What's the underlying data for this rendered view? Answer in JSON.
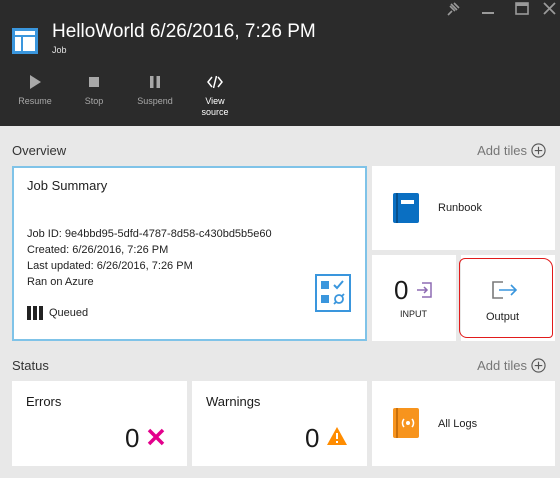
{
  "header": {
    "title": "HelloWorld 6/26/2016, 7:26 PM",
    "subtitle": "Job",
    "window_controls": [
      "pin-icon",
      "minimize-icon",
      "maximize-icon",
      "close-icon"
    ],
    "commands": [
      {
        "label": "Resume",
        "icon": "play-icon",
        "enabled": false
      },
      {
        "label": "Stop",
        "icon": "stop-icon",
        "enabled": false
      },
      {
        "label": "Suspend",
        "icon": "pause-icon",
        "enabled": false
      },
      {
        "label": "View\nsource",
        "icon": "code-icon",
        "enabled": true
      }
    ]
  },
  "overview": {
    "label": "Overview",
    "add_tiles": "Add tiles",
    "job_summary": {
      "title": "Job Summary",
      "job_id": "Job ID: 9e4bbd95-5dfd-4787-8d58-c430bd5b5e60",
      "created": "Created: 6/26/2016, 7:26 PM",
      "last_updated": "Last updated: 6/26/2016, 7:26 PM",
      "ran_on": "Ran on Azure",
      "status": "Queued"
    },
    "runbook": {
      "label": "Runbook"
    },
    "input": {
      "count": "0",
      "label": "INPUT"
    },
    "output": {
      "label": "Output"
    }
  },
  "status": {
    "label": "Status",
    "add_tiles": "Add tiles",
    "errors": {
      "label": "Errors",
      "count": "0"
    },
    "warnings": {
      "label": "Warnings",
      "count": "0"
    },
    "all_logs": {
      "label": "All Logs"
    }
  },
  "colors": {
    "header_bg": "#2b2b2b",
    "selected_border": "#7fc3e8",
    "runbook_blue": "#0a6fc2",
    "error_pink": "#e3008c",
    "warning_orange": "#ff8c00",
    "logs_orange": "#f7941d",
    "annotation_red": "#e11b1b"
  }
}
